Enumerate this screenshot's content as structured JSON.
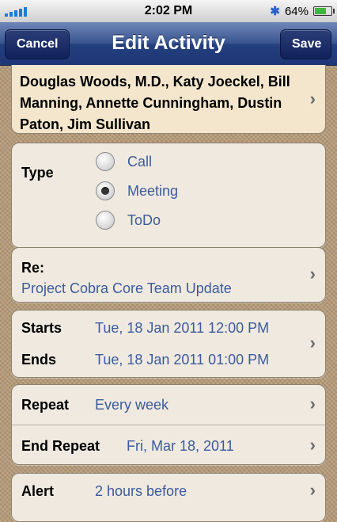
{
  "status_bar": {
    "time": "2:02 PM",
    "battery_text": "64%",
    "battery_level": 0.64,
    "bluetooth_icon": "bluetooth-icon"
  },
  "nav": {
    "title": "Edit Activity",
    "cancel_label": "Cancel",
    "save_label": "Save"
  },
  "contacts": {
    "text": "Douglas Woods, M.D., Katy Joeckel, Bill Manning, Annette Cunningham, Dustin Paton, Jim Sullivan"
  },
  "type": {
    "label": "Type",
    "options": [
      "Call",
      "Meeting",
      "ToDo"
    ],
    "selected": "Meeting"
  },
  "regarding": {
    "label": "Re:",
    "value": "Project Cobra Core Team Update"
  },
  "schedule": {
    "starts_label": "Starts",
    "starts_value": "Tue, 18 Jan 2011 12:00 PM",
    "ends_label": "Ends",
    "ends_value": "Tue, 18 Jan 2011 01:00 PM"
  },
  "repeat": {
    "repeat_label": "Repeat",
    "repeat_value": "Every week",
    "end_label": "End Repeat",
    "end_value": "Fri, Mar 18, 2011"
  },
  "alert": {
    "label": "Alert",
    "value": "2 hours before"
  },
  "colors": {
    "accent": "#3c5b9c",
    "nav_bar": "#24407e",
    "background": "#b59a78"
  }
}
